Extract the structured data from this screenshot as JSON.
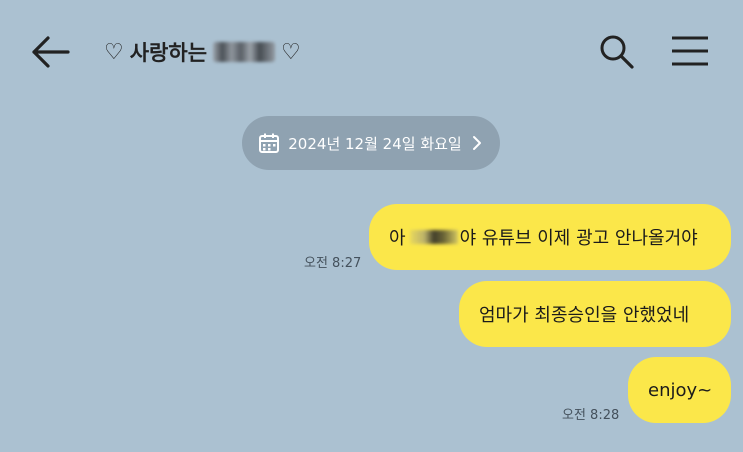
{
  "header": {
    "title_heart_left": "♡",
    "title_text": "사랑하는",
    "title_heart_right": "♡",
    "icons": [
      "back-arrow-icon",
      "search-icon",
      "hamburger-menu-icon"
    ]
  },
  "date_pill": {
    "text": "2024년 12월 24일 화요일",
    "icons": [
      "calendar-icon",
      "chevron-right-icon"
    ]
  },
  "messages": [
    {
      "prefix": "아",
      "suffix": "야 유튜브 이제 광고 안나올거야",
      "time": "오전 8:27"
    },
    {
      "text": "엄마가 최종승인을 안했었네"
    },
    {
      "text": "enjoy~",
      "time": "오전 8:28"
    }
  ],
  "colors": {
    "background": "#abc1d1",
    "bubble": "#fbe74a",
    "date_pill": "#8fa2b1"
  }
}
